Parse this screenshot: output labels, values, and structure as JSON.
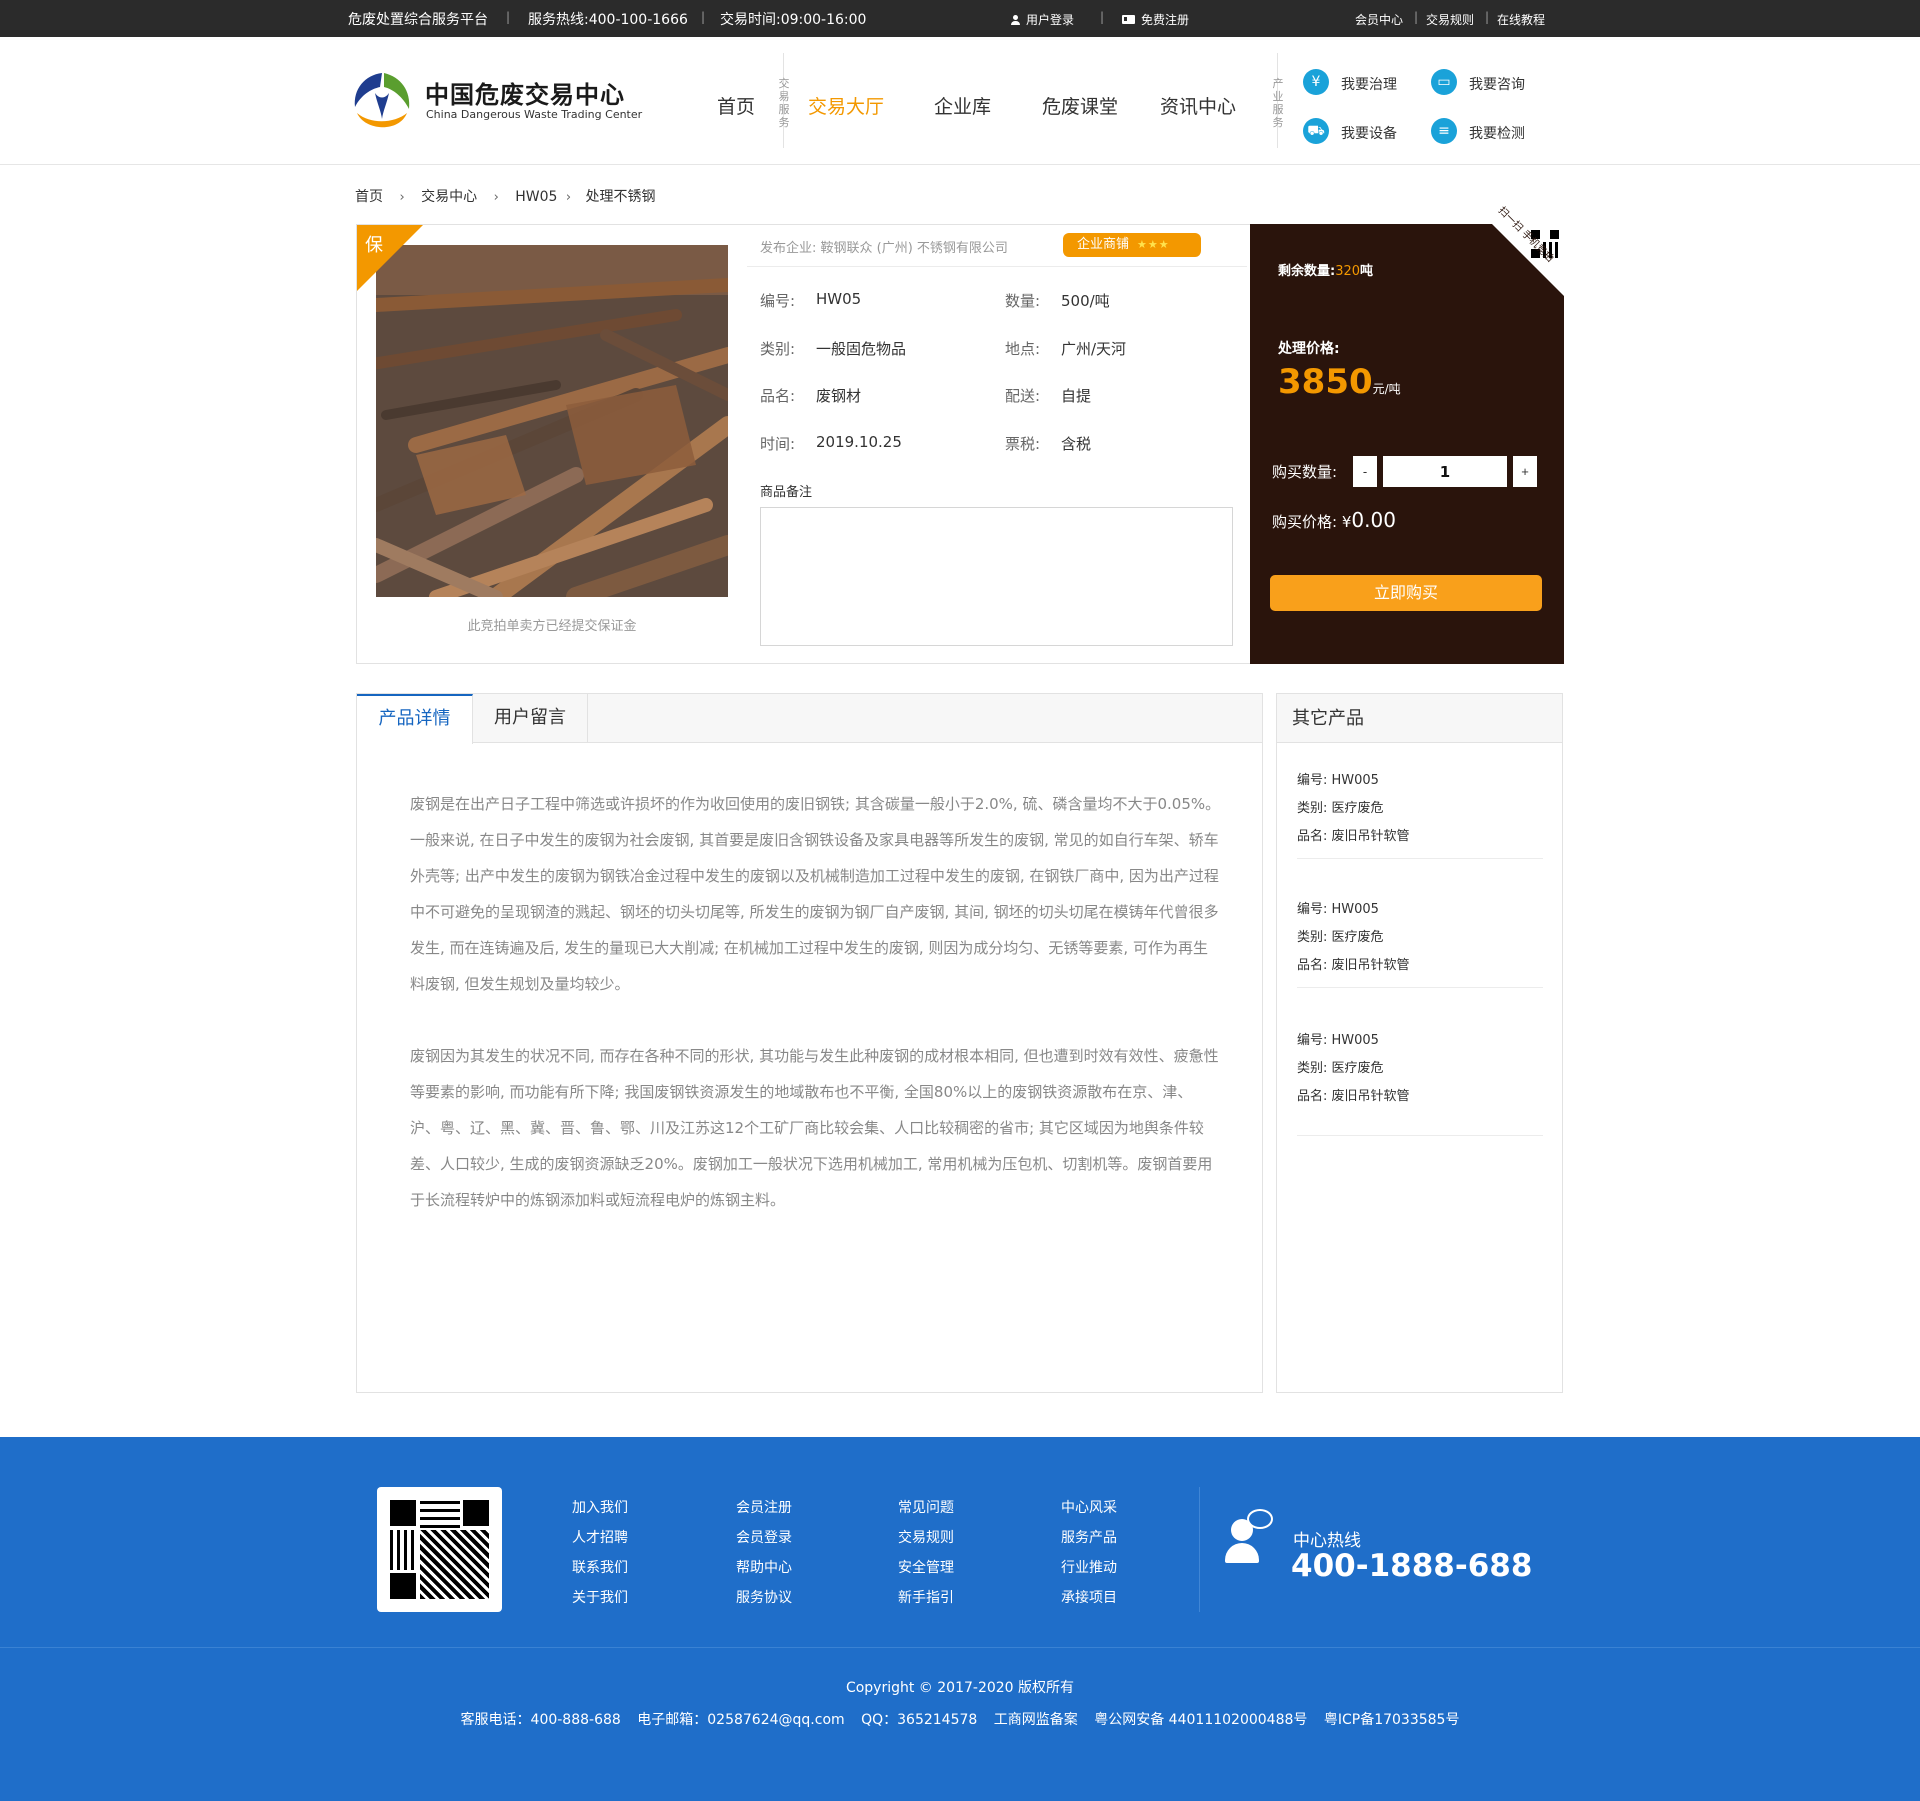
{
  "topbar": {
    "platform": "危废处置综合服务平台",
    "hotline": "服务热线:400-100-1666",
    "hours": "交易时间:09:00-16:00",
    "login": "用户登录",
    "register": "免费注册",
    "links": [
      "会员中心",
      "交易规则",
      "在线教程"
    ]
  },
  "logo": {
    "title": "中国危废交易中心",
    "subtitle": "China Dangerous Waste Trading Center"
  },
  "nav": {
    "items": [
      "首页",
      "交易大厅",
      "企业库",
      "危废课堂",
      "资讯中心"
    ],
    "active": "交易大厅",
    "group_label": "交易服务",
    "industry_label": "产业服务"
  },
  "services": [
    "我要治理",
    "我要咨询",
    "我要设备",
    "我要检测"
  ],
  "breadcrumb": [
    "首页",
    "交易中心",
    "HW05",
    "处理不锈钢"
  ],
  "product": {
    "corner_tag": "保",
    "deposit_note": "此竞拍单卖方已经提交保证金",
    "publisher": "发布企业: 鞍钢联众 (广州) 不锈钢有限公司",
    "shop_badge": "企业商铺",
    "shop_stars": "★★★",
    "fields": [
      {
        "k": "编号:",
        "v": "HW05"
      },
      {
        "k": "数量:",
        "v": "500/吨"
      },
      {
        "k": "类别:",
        "v": "一般固危物品"
      },
      {
        "k": "地点:",
        "v": "广州/天河"
      },
      {
        "k": "品名:",
        "v": "废钢材"
      },
      {
        "k": "配送:",
        "v": "自提"
      },
      {
        "k": "时间:",
        "v": "2019.10.25"
      },
      {
        "k": "票税:",
        "v": "含税"
      }
    ],
    "note_label": "商品备注"
  },
  "buy": {
    "qr_text": "扫一扫 手机竞拍",
    "remain_label": "剩余数量:",
    "remain_num": "320",
    "remain_unit": "吨",
    "price_label": "处理价格:",
    "price": "3850",
    "price_unit": "元/吨",
    "qty_label": "购买数量:",
    "minus": "-",
    "qty": "1",
    "plus": "+",
    "total_label": "购买价格:",
    "total_currency": "¥",
    "total": "0.00",
    "buy_button": "立即购买"
  },
  "tabs": [
    "产品详情",
    "用户留言"
  ],
  "article": [
    "废钢是在出产日子工程中筛选或许损坏的作为收回使用的废旧钢铁; 其含碳量一般小于2.0%, 硫、磷含量均不大于0.05%。一般来说, 在日子中发生的废钢为社会废钢, 其首要是废旧含钢铁设备及家具电器等所发生的废钢, 常见的如自行车架、轿车外壳等; 出产中发生的废钢为钢铁冶金过程中发生的废钢以及机械制造加工过程中发生的废钢, 在钢铁厂商中, 因为出产过程中不可避免的呈现钢渣的溅起、钢坯的切头切尾等, 所发生的废钢为钢厂自产废钢, 其间, 钢坯的切头切尾在模铸年代曾很多发生, 而在连铸遍及后, 发生的量现已大大削减; 在机械加工过程中发生的废钢, 则因为成分均匀、无锈等要素, 可作为再生料废钢, 但发生规划及量均较少。",
    "废钢因为其发生的状况不同, 而存在各种不同的形状, 其功能与发生此种废钢的成材根本相同, 但也遭到时效有效性、疲惫性等要素的影响, 而功能有所下降; 我国废钢铁资源发生的地域散布也不平衡, 全国80%以上的废钢铁资源散布在京、津、沪、粤、辽、黑、冀、晋、鲁、鄂、川及江苏这12个工矿厂商比较会集、人口比较稠密的省市; 其它区域因为地舆条件较差、人口较少, 生成的废钢资源缺乏20%。废钢加工一般状况下选用机械加工, 常用机械为压包机、切割机等。废钢首要用于长流程转炉中的炼钢添加料或短流程电炉的炼钢主料。"
  ],
  "others": {
    "title": "其它产品",
    "items": [
      {
        "code": "编号: HW005",
        "cat": "类别: 医疗废危",
        "name": "品名: 废旧吊针软管"
      },
      {
        "code": "编号: HW005",
        "cat": "类别: 医疗废危",
        "name": "品名: 废旧吊针软管"
      },
      {
        "code": "编号: HW005",
        "cat": "类别: 医疗废危",
        "name": "品名: 废旧吊针软管"
      }
    ]
  },
  "footer": {
    "cols": [
      [
        "加入我们",
        "人才招聘",
        "联系我们",
        "关于我们"
      ],
      [
        "会员注册",
        "会员登录",
        "帮助中心",
        "服务协议"
      ],
      [
        "常见问题",
        "交易规则",
        "安全管理",
        "新手指引"
      ],
      [
        "中心风采",
        "服务产品",
        "行业推动",
        "承接项目"
      ]
    ],
    "hotline_label": "中心热线",
    "hotline": "400-1888-688",
    "copyright": "Copyright © 2017-2020  版权所有",
    "contact": [
      "客服电话：400-888-688",
      "电子邮箱：02587624@qq.com",
      "QQ：365214578",
      "工商网监备案",
      "粤公网安备 44011102000488号",
      "粤ICP备17033585号"
    ]
  },
  "colors": {
    "accent": "#f39800",
    "brand_blue": "#1f6ec9",
    "buy_panel": "#2a140c",
    "tab_active": "#1565c0"
  }
}
